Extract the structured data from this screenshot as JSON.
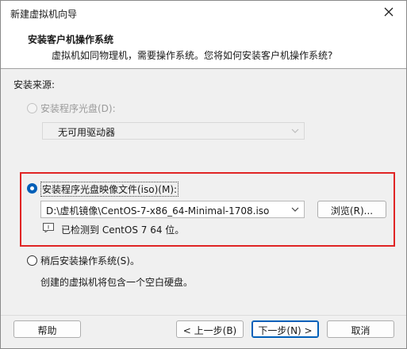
{
  "window": {
    "title": "新建虚拟机向导"
  },
  "header": {
    "title": "安装客户机操作系统",
    "subtitle": "虚拟机如同物理机，需要操作系统。您将如何安装客户机操作系统?"
  },
  "source_label": "安装来源:",
  "options": {
    "disc": {
      "label": "安装程序光盘(D):",
      "enabled": false,
      "checked": false
    },
    "disc_combo": {
      "value": "无可用驱动器"
    },
    "iso": {
      "label": "安装程序光盘映像文件(iso)(M):",
      "enabled": true,
      "checked": true
    },
    "iso_combo": {
      "value": "D:\\虚机镜像\\CentOS-7-x86_64-Minimal-1708.iso"
    },
    "browse_button": "浏览(R)...",
    "detected": "已检测到 CentOS 7 64 位。",
    "later": {
      "label": "稍后安装操作系统(S)。",
      "enabled": true,
      "checked": false
    },
    "later_desc": "创建的虚拟机将包含一个空白硬盘。"
  },
  "footer": {
    "help": "帮助",
    "back": "< 上一步(B)",
    "next": "下一步(N) >",
    "cancel": "取消"
  },
  "colors": {
    "accent": "#005fb8",
    "highlight": "#e02424"
  }
}
